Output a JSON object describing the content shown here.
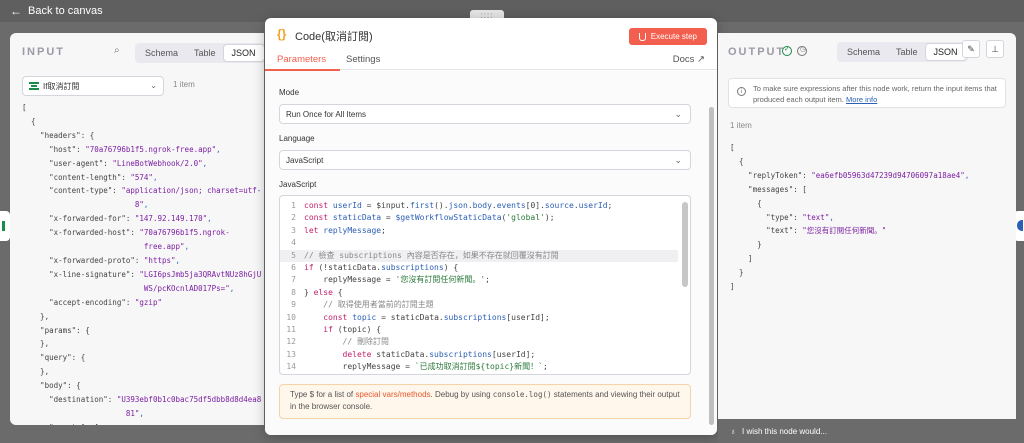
{
  "topbar": {
    "back_label": "Back to canvas"
  },
  "input": {
    "title": "INPUT",
    "tabs": [
      "Schema",
      "Table",
      "JSON"
    ],
    "active_tab": "JSON",
    "node_select": "If取消訂閱",
    "items_count": "1 item",
    "json_lines": [
      [
        "[",
        "",
        ""
      ],
      [
        "  {",
        "",
        ""
      ],
      [
        "    \"headers\": {",
        "",
        ""
      ],
      [
        "      \"host\": ",
        "\"70a76796b1f5.ngrok-free.app\"",
        ","
      ],
      [
        "      \"user-agent\": ",
        "\"LineBotWebhook/2.0\"",
        ","
      ],
      [
        "      \"content-length\": ",
        "\"574\"",
        ","
      ],
      [
        "      \"content-type\": ",
        "\"application/json; charset=utf-",
        ""
      ],
      [
        "                         ",
        "8\"",
        ","
      ],
      [
        "      \"x-forwarded-for\": ",
        "\"147.92.149.170\"",
        ","
      ],
      [
        "      \"x-forwarded-host\": ",
        "\"70a76796b1f5.ngrok-",
        ""
      ],
      [
        "                           ",
        "free.app\"",
        ","
      ],
      [
        "      \"x-forwarded-proto\": ",
        "\"https\"",
        ","
      ],
      [
        "      \"x-line-signature\": ",
        "\"LGI6psJmb5ja3QRAvtNUz8hGjU",
        ""
      ],
      [
        "                           ",
        "WS/pcKOcnlAD017Ps=\"",
        ","
      ],
      [
        "      \"accept-encoding\": ",
        "\"gzip\"",
        ""
      ],
      [
        "    },",
        "",
        ""
      ],
      [
        "    \"params\": {",
        "",
        ""
      ],
      [
        "    },",
        "",
        ""
      ],
      [
        "    \"query\": {",
        "",
        ""
      ],
      [
        "    },",
        "",
        ""
      ],
      [
        "    \"body\": {",
        "",
        ""
      ],
      [
        "      \"destination\": ",
        "\"U393ebf0b1c0bac75df5dbb8d8d4ea8",
        ""
      ],
      [
        "                       ",
        "81\"",
        ","
      ],
      [
        "      \"events\": [",
        "",
        ""
      ]
    ]
  },
  "dialog": {
    "title": "Code(取消訂閱)",
    "execute_label": "Execute step",
    "tabs": {
      "parameters": "Parameters",
      "settings": "Settings",
      "docs": "Docs"
    },
    "mode_label": "Mode",
    "mode_value": "Run Once for All Items",
    "language_label": "Language",
    "language_value": "JavaScript",
    "code_label": "JavaScript",
    "code_lines": [
      {
        "n": "1",
        "html": "<span class='kw'>const</span> <span class='vr'>userId</span> = $input.<span class='vr'>first</span>().<span class='vr'>json</span>.<span class='vr'>body</span>.<span class='vr'>events</span>[0].<span class='vr'>source</span>.<span class='vr'>userId</span>;"
      },
      {
        "n": "2",
        "html": "<span class='kw'>const</span> <span class='vr'>staticData</span> = <span class='vr'>$getWorkflowStaticData</span>(<span class='st'>'global'</span>);"
      },
      {
        "n": "3",
        "html": "<span class='kw'>let</span> <span class='vr'>replyMessage</span>;"
      },
      {
        "n": "4",
        "html": ""
      },
      {
        "n": "5",
        "html": "<span class='cm'>// 檢查 subscriptions 內容是否存在，如果不存在就回覆沒有訂閱</span>"
      },
      {
        "n": "6",
        "html": "<span class='kw'>if</span> (!staticData.<span class='vr'>subscriptions</span>) {"
      },
      {
        "n": "7",
        "html": "    replyMessage = <span class='st'>'您沒有訂閱任何新聞。'</span>;"
      },
      {
        "n": "8",
        "html": "} <span class='kw'>else</span> {"
      },
      {
        "n": "9",
        "html": "    <span class='cm'>// 取得使用者當前的訂閱主題</span>"
      },
      {
        "n": "10",
        "html": "    <span class='kw'>const</span> <span class='vr'>topic</span> = staticData.<span class='vr'>subscriptions</span>[userId];"
      },
      {
        "n": "11",
        "html": "    <span class='kw'>if</span> (topic) {"
      },
      {
        "n": "12",
        "html": "        <span class='cm'>// 刪除訂閱</span>"
      },
      {
        "n": "13",
        "html": "        <span class='kw'>delete</span> staticData.<span class='vr'>subscriptions</span>[userId];"
      },
      {
        "n": "14",
        "html": "        replyMessage = <span class='st'>`已成功取消訂閱${topic}新聞！`</span>;"
      }
    ],
    "hint": {
      "pre": "Type $ for a list of ",
      "link": "special vars/methods",
      "mid": ". Debug by using ",
      "code": "console.log()",
      "post": " statements and viewing their output in the browser console."
    }
  },
  "output": {
    "title": "OUTPUT",
    "tabs": [
      "Schema",
      "Table",
      "JSON"
    ],
    "active_tab": "JSON",
    "info_text": "To make sure expressions after this node work, return the input items that produced each output item.",
    "info_link": "More info",
    "items_count": "1 item",
    "json_lines": [
      [
        "[",
        "",
        ""
      ],
      [
        "  {",
        "",
        ""
      ],
      [
        "    \"replyToken\": ",
        "\"ea6efb05963d47239d94706097a18ae4\"",
        ","
      ],
      [
        "    \"messages\": [",
        "",
        ""
      ],
      [
        "      {",
        "",
        ""
      ],
      [
        "        \"type\": ",
        "\"text\"",
        ","
      ],
      [
        "        \"text\": ",
        "\"您沒有訂閱任何新聞。\"",
        ""
      ],
      [
        "      }",
        "",
        ""
      ],
      [
        "    ]",
        "",
        ""
      ],
      [
        "  }",
        "",
        ""
      ],
      [
        "]",
        "",
        ""
      ]
    ],
    "wish_label": "I wish this node would..."
  },
  "colors": {
    "accent": "#f35f4e",
    "string": "#7b1fa2",
    "keyword": "#c0206a"
  }
}
